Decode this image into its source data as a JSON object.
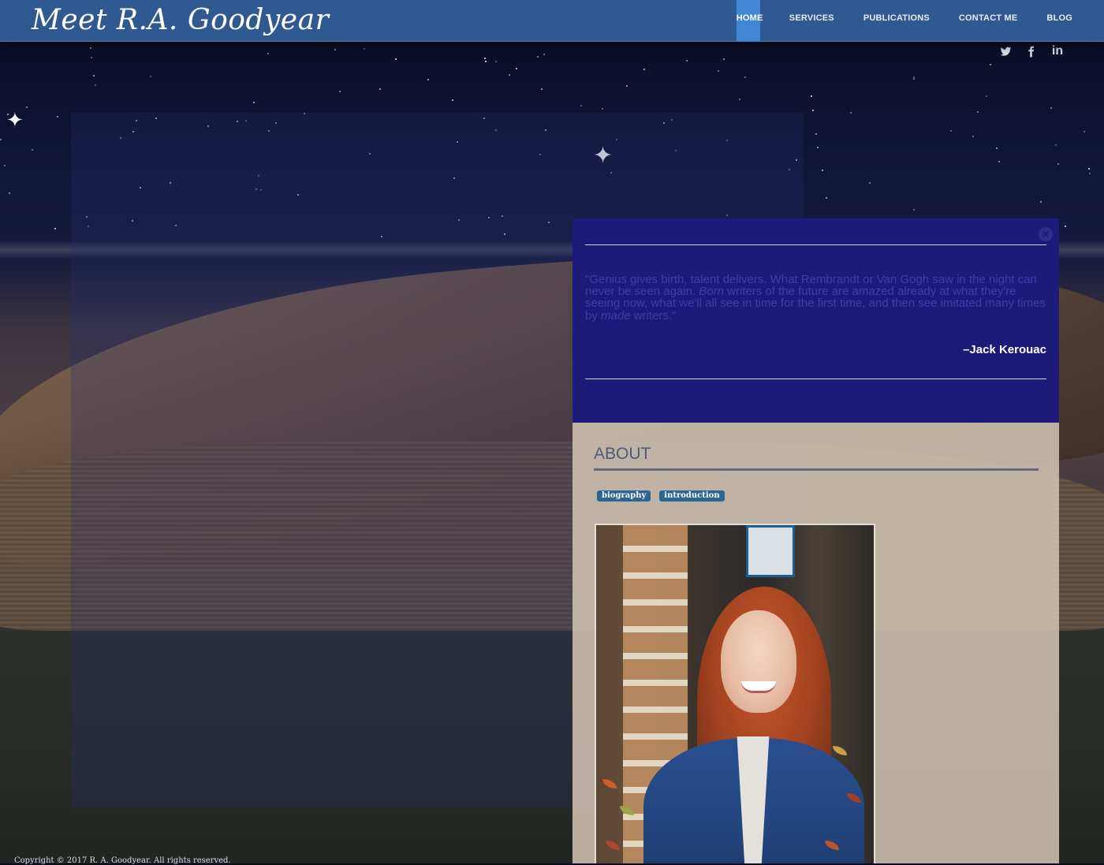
{
  "site": {
    "logo": "Meet R.A. Goodyear"
  },
  "nav": {
    "items": [
      {
        "label": "HOME",
        "active": true
      },
      {
        "label": "SERVICES",
        "active": false
      },
      {
        "label": "PUBLICATIONS",
        "active": false
      },
      {
        "label": "CONTACT ME",
        "active": false
      },
      {
        "label": "BLOG",
        "active": false
      }
    ]
  },
  "social": {
    "icons": [
      "twitter-icon",
      "facebook-icon",
      "linkedin-icon"
    ],
    "linkedin_text": "in"
  },
  "quote": {
    "text_part1": "\"Genius gives birth, talent delivers. What Rembrandt or Van Gogh saw in the night can never be seen again. ",
    "emph1": "Born",
    "text_part2": " writers of the future are amazed already at what they're seeing now, what we'll all see in time for the first time, and then see imitated many times by ",
    "emph2": "made",
    "text_part3": " writers.\"",
    "author": "–Jack Kerouac"
  },
  "about": {
    "title": "ABOUT",
    "tags": [
      "biography",
      "introduction"
    ]
  },
  "footer": {
    "copyright": "Copyright © 2017 R. A. Goodyear. All rights reserved."
  },
  "colors": {
    "navbar": "#2f5990",
    "nav_active": "#4187d6",
    "quote_box": "#1c1b7a",
    "quote_text": "#3a3fa8",
    "about_bg": "#cfc2b1",
    "tag_bg": "#2a6694"
  }
}
